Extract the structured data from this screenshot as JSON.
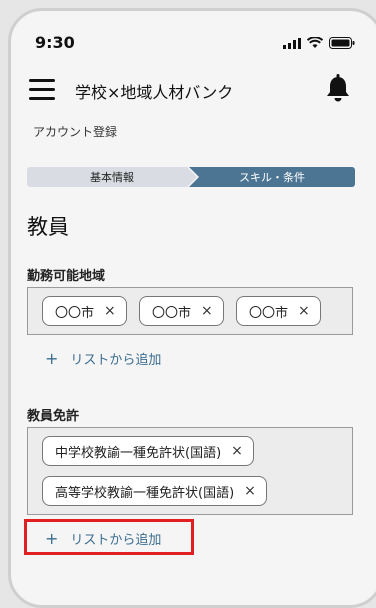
{
  "status": {
    "time": "9:30"
  },
  "header": {
    "title": "学校×地域人材バンク"
  },
  "page_label": "アカウント登録",
  "stepper": {
    "step1": "基本情報",
    "step2": "スキル・条件"
  },
  "section_title": "教員",
  "areas": {
    "label": "勤務可能地域",
    "chips": [
      "〇〇市",
      "〇〇市",
      "〇〇市"
    ],
    "add_label": "リストから追加"
  },
  "licenses": {
    "label": "教員免許",
    "chips": [
      "中学校教諭一種免許状(国語)",
      "高等学校教諭一種免許状(国語)"
    ],
    "add_label": "リストから追加"
  },
  "icons": {
    "close": "×",
    "plus": "+"
  },
  "colors": {
    "accent": "#4c7594",
    "link": "#3a6c8f",
    "highlight": "#e02020"
  }
}
